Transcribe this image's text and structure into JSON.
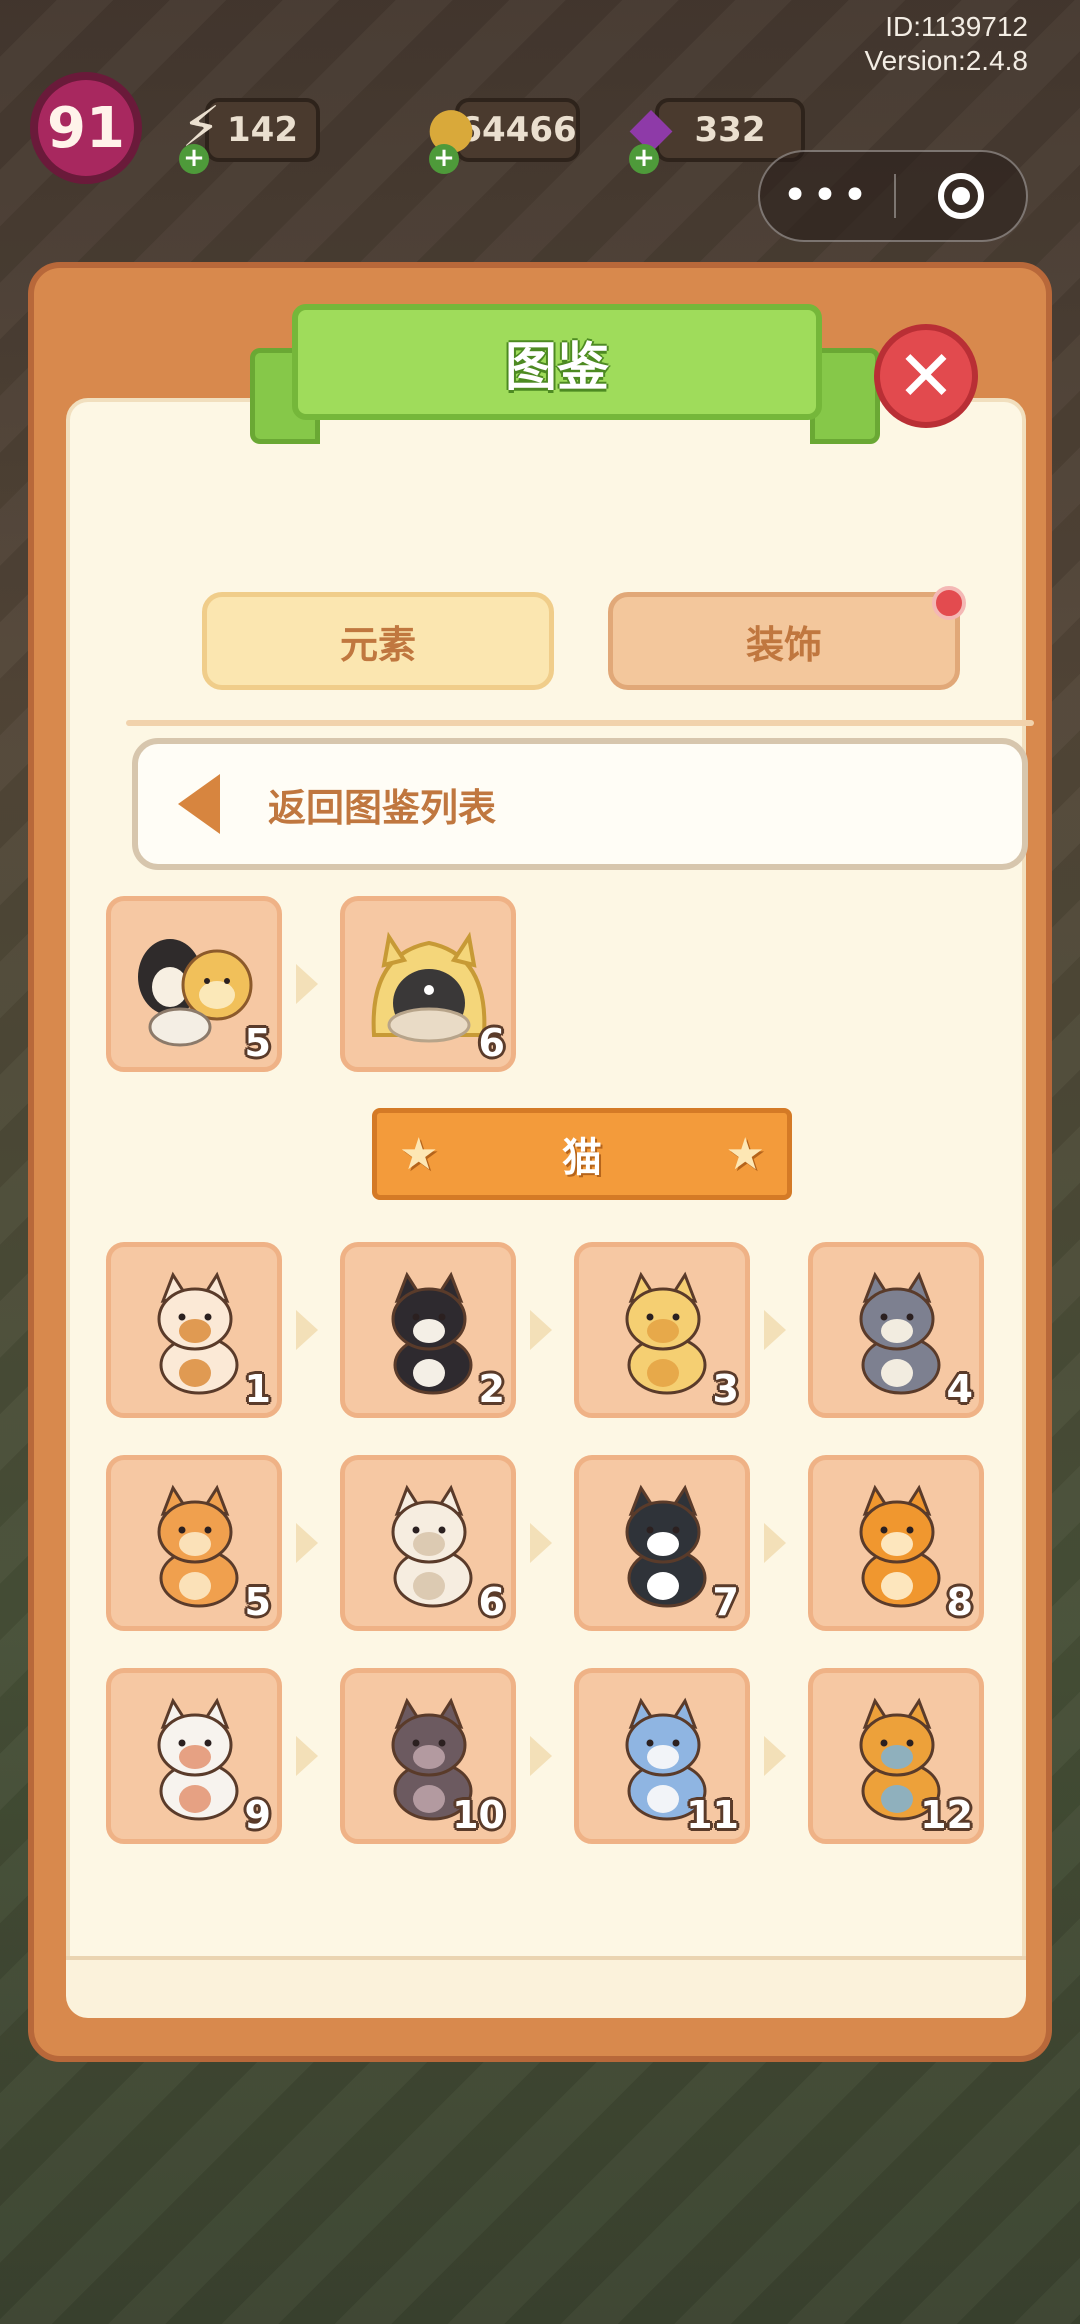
{
  "hud": {
    "level": "91",
    "energy": "142",
    "coins": "64466",
    "gems": "332",
    "user_id": "ID:1139712",
    "version": "Version:2.4.8"
  },
  "capsule": {
    "more": "•••"
  },
  "modal": {
    "title": "图鉴",
    "tabs": [
      {
        "label": "元素",
        "state": "selected"
      },
      {
        "label": "装饰",
        "state": "normal",
        "has_notification": true
      }
    ],
    "back_label": "返回图鉴列表",
    "prev_chain": [
      {
        "num": "5",
        "icon": "hamster-family"
      },
      {
        "num": "6",
        "icon": "yellow-cat-bed"
      }
    ],
    "category_title": "猫",
    "cats": [
      {
        "num": "1",
        "icon": "calico-kitten",
        "body": "#fbe9d6",
        "patch": "#e09a52"
      },
      {
        "num": "2",
        "icon": "black-kitten",
        "body": "#2e2a2f",
        "patch": "#f4efe6"
      },
      {
        "num": "3",
        "icon": "fluffy-yellow-kitten",
        "body": "#f5cf72",
        "patch": "#e7a94a"
      },
      {
        "num": "4",
        "icon": "gray-kitten",
        "body": "#7d8090",
        "patch": "#f2ece0"
      },
      {
        "num": "5",
        "icon": "orange-cat",
        "body": "#f0a04e",
        "patch": "#fbe1b8"
      },
      {
        "num": "6",
        "icon": "sleeping-white-cat",
        "body": "#f6ede0",
        "patch": "#dccab2"
      },
      {
        "num": "7",
        "icon": "tuxedo-cat",
        "body": "#2f3339",
        "patch": "#ffffff"
      },
      {
        "num": "8",
        "icon": "shiba-orange-cat",
        "body": "#f0972f",
        "patch": "#fde6bd"
      },
      {
        "num": "9",
        "icon": "white-fluffy-cat",
        "body": "#f7f3ee",
        "patch": "#e6a183"
      },
      {
        "num": "10",
        "icon": "sphynx-cat",
        "body": "#6c5a60",
        "patch": "#b39aa0"
      },
      {
        "num": "11",
        "icon": "blue-longhair-cat",
        "body": "#8fb5e2",
        "patch": "#f2f4f8"
      },
      {
        "num": "12",
        "icon": "tabby-cat-with-fish",
        "body": "#eda13a",
        "patch": "#8fb0bd"
      }
    ]
  }
}
